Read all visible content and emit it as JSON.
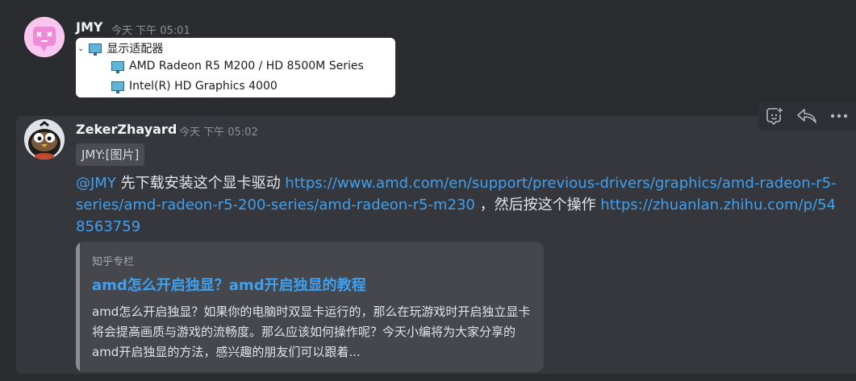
{
  "message1": {
    "author": "JMY",
    "time": "今天 下午 05:01",
    "screenshot": {
      "root_label": "显示适配器",
      "devices": [
        "AMD Radeon R5 M200 / HD 8500M Series",
        "Intel(R) HD Graphics 4000"
      ]
    }
  },
  "message2": {
    "author": "ZekerZhayard",
    "time": "今天 下午 05:02",
    "quote": "JMY:[图片]",
    "mention": "@JMY",
    "text_before": " 先下载安装这个显卡驱动 ",
    "link1": "https://www.amd.com/en/support/previous-drivers/graphics/amd-radeon-r5-series/amd-radeon-r5-200-series/amd-radeon-r5-m230",
    "text_middle": " ，然后按这个操作 ",
    "link2": "https://zhuanlan.zhihu.com/p/548563759",
    "card": {
      "source": "知乎专栏",
      "title": "amd怎么开启独显？amd开启独显的教程",
      "description": "amd怎么开启独显？如果你的电脑时双显卡运行的，那么在玩游戏时开启独立显卡将会提高画质与游戏的流畅度。那么应该如何操作呢？今天小编将为大家分享的amd开启独显的方法，感兴趣的朋友们可以跟着..."
    }
  },
  "toolbar": {
    "icons": [
      "add-reaction-icon",
      "reply-icon",
      "more-icon"
    ]
  },
  "colors": {
    "background": "#2b2c30",
    "message_highlight": "#36373c",
    "link": "#3fa0f0"
  }
}
